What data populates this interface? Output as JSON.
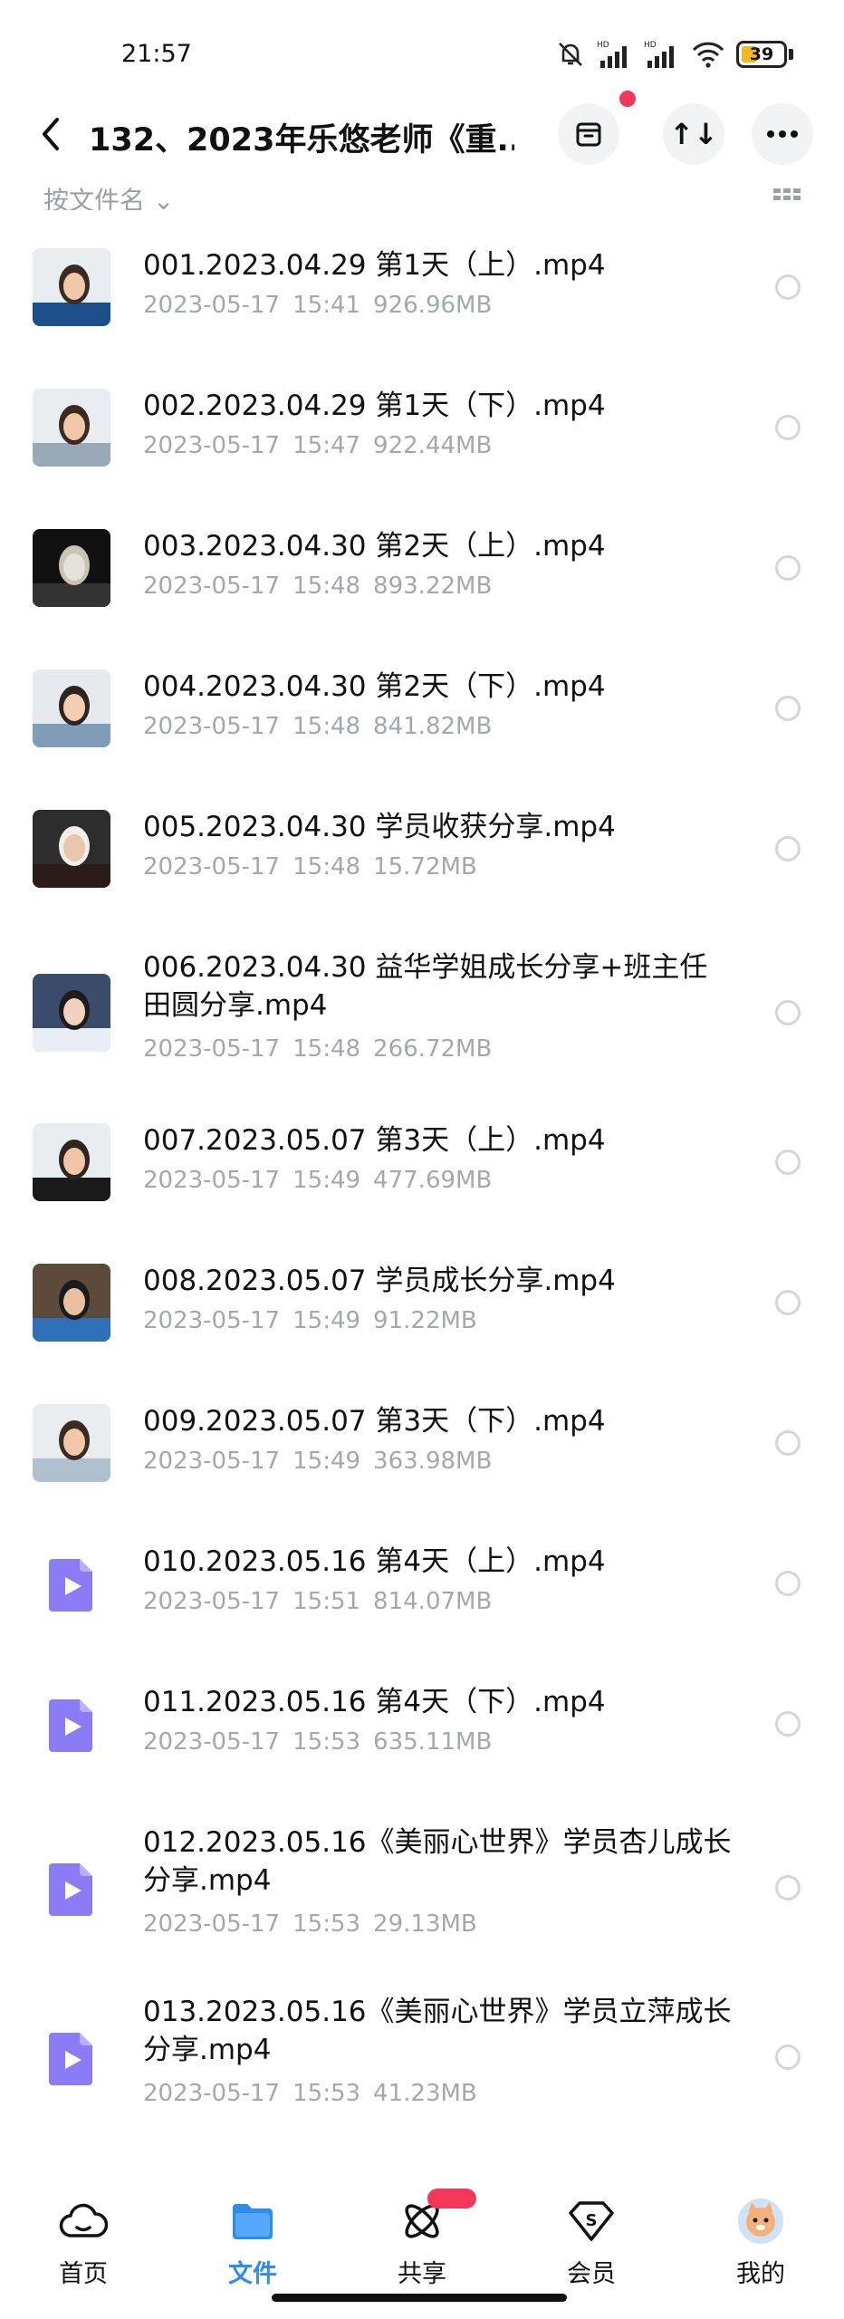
{
  "status_bar": {
    "time": "21:57",
    "battery": "39",
    "battery_level": 0.39
  },
  "header": {
    "title": "132、2023年乐悠老师《重...",
    "back_icon": "chevron-left-icon",
    "archive_icon": "archive-icon",
    "sort_icon": "↑↓",
    "more_icon": "more-icon"
  },
  "sort_row": {
    "label": "按文件名 ⌄"
  },
  "files": [
    {
      "name": "001.2023.04.29 第1天（上）.mp4",
      "date": "2023-05-17",
      "time": "15:41",
      "size": "926.96MB",
      "thumb": "photo-icon"
    },
    {
      "name": "002.2023.04.29 第1天（下）.mp4",
      "date": "2023-05-17",
      "time": "15:47",
      "size": "922.44MB",
      "thumb": "photo-icon"
    },
    {
      "name": "003.2023.04.30 第2天（上）.mp4",
      "date": "2023-05-17",
      "time": "15:48",
      "size": "893.22MB",
      "thumb": "photo-icon"
    },
    {
      "name": "004.2023.04.30 第2天（下）.mp4",
      "date": "2023-05-17",
      "time": "15:48",
      "size": "841.82MB",
      "thumb": "photo-icon"
    },
    {
      "name": "005.2023.04.30  学员收获分享.mp4",
      "date": "2023-05-17",
      "time": "15:48",
      "size": "15.72MB",
      "thumb": "photo-icon"
    },
    {
      "name": "006.2023.04.30 益华学姐成长分享+班主任田圆分享.mp4",
      "date": "2023-05-17",
      "time": "15:48",
      "size": "266.72MB",
      "thumb": "photo-icon"
    },
    {
      "name": "007.2023.05.07 第3天（上）.mp4",
      "date": "2023-05-17",
      "time": "15:49",
      "size": "477.69MB",
      "thumb": "photo-icon"
    },
    {
      "name": "008.2023.05.07 学员成长分享.mp4",
      "date": "2023-05-17",
      "time": "15:49",
      "size": "91.22MB",
      "thumb": "photo-icon"
    },
    {
      "name": "009.2023.05.07 第3天（下）.mp4",
      "date": "2023-05-17",
      "time": "15:49",
      "size": "363.98MB",
      "thumb": "photo-icon"
    },
    {
      "name": "010.2023.05.16 第4天（上）.mp4",
      "date": "2023-05-17",
      "time": "15:51",
      "size": "814.07MB",
      "thumb": "video-file-icon"
    },
    {
      "name": "011.2023.05.16 第4天（下）.mp4",
      "date": "2023-05-17",
      "time": "15:53",
      "size": "635.11MB",
      "thumb": "video-file-icon"
    },
    {
      "name": "012.2023.05.16《美丽心世界》学员杏儿成长分享.mp4",
      "date": "2023-05-17",
      "time": "15:53",
      "size": "29.13MB",
      "thumb": "video-file-icon"
    },
    {
      "name": "013.2023.05.16《美丽心世界》学员立萍成长分享.mp4",
      "date": "2023-05-17",
      "time": "15:53",
      "size": "41.23MB",
      "thumb": "video-file-icon"
    }
  ],
  "nav": [
    {
      "label": "首页",
      "icon": "cloud-home-icon",
      "active": false
    },
    {
      "label": "文件",
      "icon": "folder-icon",
      "active": true
    },
    {
      "label": "共享",
      "icon": "share-atom-icon",
      "active": false
    },
    {
      "label": "会员",
      "icon": "vip-diamond-icon",
      "active": false
    },
    {
      "label": "我的",
      "icon": "avatar-icon",
      "active": false
    }
  ],
  "colors": {
    "accent": "#2c8cf4",
    "video_icon": "#8a7cf5",
    "meta_text": "#a3a8b0",
    "badge": "#f4365b"
  }
}
